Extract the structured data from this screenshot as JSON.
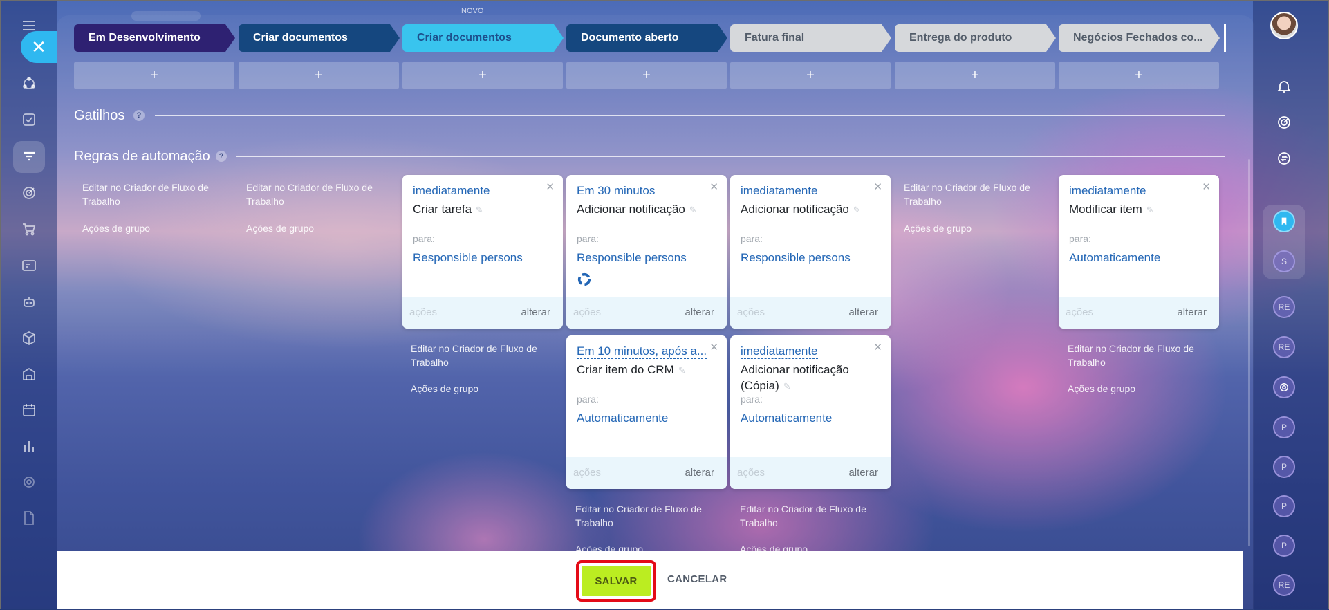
{
  "colors": {
    "stage_dark": "#2e2172",
    "stage_navy": "#15477f",
    "stage_cyan": "#39c4ee",
    "stage_grey": "#d6d8db",
    "link_blue": "#2467b6",
    "save_green": "#bbed21",
    "highlight_red": "#e40b17"
  },
  "topbar": {
    "new_tag": "NOVO"
  },
  "left_nav": {
    "close_icon": "close-icon",
    "icons": [
      "menu-icon",
      "network-icon",
      "tasks-icon",
      "crm-funnel-icon",
      "target-icon",
      "cart-icon",
      "contact-card-icon",
      "robot-icon",
      "box-icon",
      "building-icon",
      "calendar-icon",
      "chart-icon",
      "settings-icon",
      "document-icon"
    ]
  },
  "stages": [
    {
      "label": "Em Desenvolvimento",
      "color": "#2e2172",
      "text_color": "#ffffff"
    },
    {
      "label": "Criar documentos",
      "color": "#15477f",
      "text_color": "#ffffff"
    },
    {
      "label": "Criar documentos",
      "color": "#39c4ee",
      "text_color": "#1d4f8c"
    },
    {
      "label": "Documento aberto",
      "color": "#15477f",
      "text_color": "#ffffff"
    },
    {
      "label": "Fatura final",
      "color": "#d6d8db",
      "text_color": "#525c69"
    },
    {
      "label": "Entrega do produto",
      "color": "#d6d8db",
      "text_color": "#525c69"
    },
    {
      "label": "Negócios Fechados co...",
      "color": "#d6d8db",
      "text_color": "#525c69"
    }
  ],
  "plus_symbol": "+",
  "triggers": {
    "title": "Gatilhos",
    "help": "?"
  },
  "rules": {
    "title": "Regras de automação",
    "help": "?"
  },
  "column_links": {
    "edit": "Editar no Criador de Fluxo de Trabalho",
    "group": "Ações de grupo"
  },
  "cards": [
    {
      "when": "imediatamente",
      "action": "Criar tarefa",
      "para": "para:",
      "target": "Responsible persons",
      "acoes": "ações",
      "alterar": "alterar"
    },
    {
      "when": "Em 30 minutos",
      "action": "Adicionar notificação",
      "para": "para:",
      "target": "Responsible persons",
      "acoes": "ações",
      "alterar": "alterar"
    },
    {
      "when": "imediatamente",
      "action": "Adicionar notificação",
      "para": "para:",
      "target": "Responsible persons",
      "acoes": "ações",
      "alterar": "alterar"
    },
    {
      "when": "imediatamente",
      "action": "Modificar item",
      "para": "para:",
      "target": "Automaticamente",
      "acoes": "ações",
      "alterar": "alterar"
    },
    {
      "when": "Em 10 minutos, após a...",
      "action": "Criar item do CRM",
      "para": "para:",
      "target": "Automaticamente",
      "acoes": "ações",
      "alterar": "alterar"
    },
    {
      "when": "imediatamente",
      "action": "Adicionar notificação (Cópia)",
      "para": "para:",
      "target": "Automaticamente",
      "acoes": "ações",
      "alterar": "alterar"
    }
  ],
  "footer": {
    "save": "SALVAR",
    "cancel": "CANCELAR"
  },
  "right_rail": {
    "icons": [
      "bell-icon",
      "target-icon",
      "sync-chat-icon",
      "bookmark-icon"
    ],
    "avatars": [
      "S",
      "RE",
      "RE",
      "P",
      "P",
      "P",
      "P",
      "RE"
    ]
  }
}
